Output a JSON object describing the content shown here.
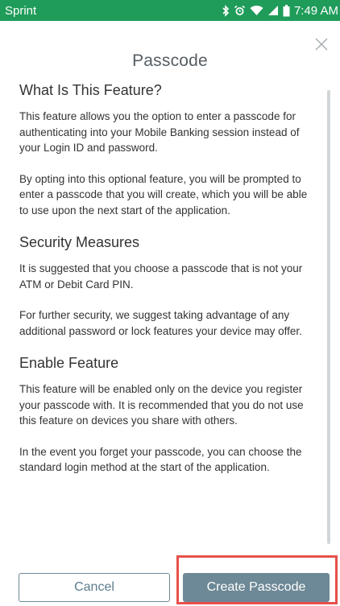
{
  "status_bar": {
    "carrier": "Sprint",
    "time": "7:49 AM",
    "background": "#1f9c5a",
    "icons": [
      "bluetooth-icon",
      "alarm-icon",
      "wifi-icon",
      "signal-icon",
      "battery-icon"
    ]
  },
  "modal": {
    "title": "Passcode",
    "close_icon": "close-icon",
    "sections": [
      {
        "heading": "What Is This Feature?",
        "paragraphs": [
          "This feature allows you the option to enter a passcode for authenticating into your Mobile Banking session instead of your Login ID and password.",
          "By opting into this optional feature, you will be prompted to enter a passcode that you will create, which you will be able to use upon the next start of the application."
        ]
      },
      {
        "heading": "Security Measures",
        "paragraphs": [
          "It is suggested that you choose a passcode that is not your ATM or Debit Card PIN.",
          "For further security, we suggest taking advantage of any additional password or lock features your device may offer."
        ]
      },
      {
        "heading": "Enable Feature",
        "paragraphs": [
          "This feature will be enabled only on the device you register your passcode with. It is recommended that you do not use this feature on devices you share with others.",
          "In the event you forget your passcode, you can choose the standard login method at the start of the application."
        ]
      }
    ],
    "cancel_label": "Cancel",
    "create_label": "Create Passcode",
    "accent_color": "#6d8896",
    "highlight_color": "#e8504a"
  }
}
